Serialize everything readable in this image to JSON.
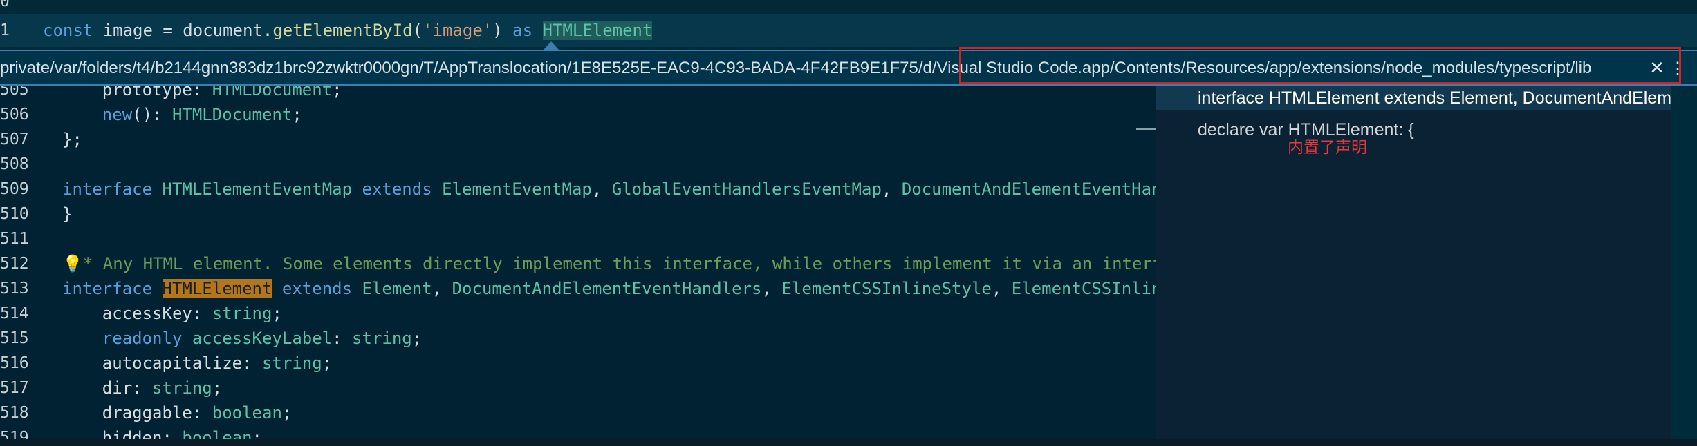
{
  "top": {
    "line_number_prev": "0",
    "line_number": "1",
    "code": {
      "kw_const": "const",
      "var_name": " image = ",
      "object": "document",
      "dot": ".",
      "method": "getElementById",
      "open_paren": "(",
      "arg": "'image'",
      "close_paren": ") ",
      "kw_as": "as",
      "space": " ",
      "type": "HTMLElement"
    }
  },
  "peek": {
    "path": "private/var/folders/t4/b2144gnn383dz1brc92zwktr0000gn/T/AppTranslocation/1E8E525E-EAC9-4C93-BADA-4F42FB9E1F75/d/Visual Studio Code.app/Contents/Resources/app/extensions/node_modules/typescript/lib",
    "close_icon": "✕",
    "more_icon": "⋮",
    "side": {
      "items": [
        "interface HTMLElement extends Element, DocumentAndElementEventHandlers",
        "declare var HTMLElement: {"
      ],
      "note": "内置了声明"
    },
    "lines": [
      {
        "num": "506",
        "parts": [
          [
            "txt",
            "    "
          ],
          [
            "kw",
            "new"
          ],
          [
            "txt",
            "(): "
          ],
          [
            "type",
            "HTMLDocument"
          ],
          [
            "txt",
            ";"
          ]
        ]
      },
      {
        "num": "507",
        "parts": [
          [
            "txt",
            "};"
          ]
        ]
      },
      {
        "num": "508",
        "parts": [
          [
            "txt",
            ""
          ]
        ]
      },
      {
        "num": "509",
        "parts": [
          [
            "kw",
            "interface"
          ],
          [
            "txt",
            " "
          ],
          [
            "type",
            "HTMLElementEventMap"
          ],
          [
            "txt",
            " "
          ],
          [
            "kw",
            "extends"
          ],
          [
            "txt",
            " "
          ],
          [
            "type",
            "ElementEventMap"
          ],
          [
            "txt",
            ", "
          ],
          [
            "type",
            "GlobalEventHandlersEventMap"
          ],
          [
            "txt",
            ", "
          ],
          [
            "type",
            "DocumentAndElementEventHandlersEventMap"
          ]
        ]
      },
      {
        "num": "510",
        "parts": [
          [
            "txt",
            "}"
          ]
        ]
      },
      {
        "num": "511",
        "parts": [
          [
            "txt",
            ""
          ]
        ]
      },
      {
        "num": "512",
        "parts": [
          [
            "txt",
            "💡"
          ],
          [
            "comment",
            "* Any HTML element. Some elements directly implement this interface, while others implement it via an interface that inherits it. */"
          ]
        ]
      },
      {
        "num": "513",
        "parts": [
          [
            "kw",
            "interface"
          ],
          [
            "txt",
            " "
          ],
          [
            "hl",
            "HTMLElement"
          ],
          [
            "txt",
            " "
          ],
          [
            "kw",
            "extends"
          ],
          [
            "txt",
            " "
          ],
          [
            "type",
            "Element"
          ],
          [
            "txt",
            ", "
          ],
          [
            "type",
            "DocumentAndElementEventHandlers"
          ],
          [
            "txt",
            ", "
          ],
          [
            "type",
            "ElementCSSInlineStyle"
          ],
          [
            "txt",
            ", "
          ],
          [
            "type",
            "ElementCSSInlineStyle"
          ]
        ]
      },
      {
        "num": "514",
        "parts": [
          [
            "txt",
            "    accessKey: "
          ],
          [
            "type",
            "string"
          ],
          [
            "txt",
            ";"
          ]
        ]
      },
      {
        "num": "515",
        "parts": [
          [
            "txt",
            "    "
          ],
          [
            "kw",
            "readonly"
          ],
          [
            "txt",
            " "
          ],
          [
            "type",
            "accessKeyLabel"
          ],
          [
            "txt",
            ": "
          ],
          [
            "type",
            "string"
          ],
          [
            "txt",
            ";"
          ]
        ]
      },
      {
        "num": "516",
        "parts": [
          [
            "txt",
            "    autocapitalize: "
          ],
          [
            "type",
            "string"
          ],
          [
            "txt",
            ";"
          ]
        ]
      },
      {
        "num": "517",
        "parts": [
          [
            "txt",
            "    dir: "
          ],
          [
            "type",
            "string"
          ],
          [
            "txt",
            ";"
          ]
        ]
      },
      {
        "num": "518",
        "parts": [
          [
            "txt",
            "    draggable: "
          ],
          [
            "type",
            "boolean"
          ],
          [
            "txt",
            ";"
          ]
        ]
      },
      {
        "num": "519",
        "parts": [
          [
            "txt",
            "    hidden: "
          ],
          [
            "type",
            "boolean"
          ],
          [
            "txt",
            ";"
          ]
        ]
      }
    ],
    "partial_top_line": {
      "num": "505",
      "parts": [
        [
          "txt",
          "    prototype: "
        ],
        [
          "type",
          "HTMLDocument"
        ],
        [
          "txt",
          ";"
        ]
      ]
    }
  }
}
